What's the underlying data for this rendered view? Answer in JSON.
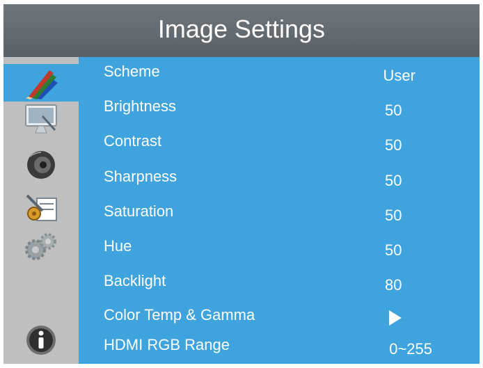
{
  "header": {
    "title": "Image Settings"
  },
  "sidebar": {
    "items": [
      {
        "icon": "color-pencils-icon",
        "active": true
      },
      {
        "icon": "monitor-icon",
        "active": false
      },
      {
        "icon": "speaker-icon",
        "active": false
      },
      {
        "icon": "tools-icon",
        "active": false
      },
      {
        "icon": "gears-icon",
        "active": false
      },
      {
        "icon": "info-icon",
        "active": false
      }
    ]
  },
  "menu": {
    "rows": [
      {
        "label": "Scheme",
        "value": "User"
      },
      {
        "label": "Brightness",
        "value": "50"
      },
      {
        "label": "Contrast",
        "value": "50"
      },
      {
        "label": "Sharpness",
        "value": "50"
      },
      {
        "label": "Saturation",
        "value": "50"
      },
      {
        "label": "Hue",
        "value": "50"
      },
      {
        "label": "Backlight",
        "value": "80"
      },
      {
        "label": "Color Temp & Gamma",
        "value": ""
      },
      {
        "label": "HDMI RGB Range",
        "value": "0~255"
      }
    ]
  },
  "colors": {
    "header_bg": "#5f676c",
    "panel_bg": "#3fa3dd",
    "sidebar_bg": "#bfbfbf",
    "text": "#ffffff"
  }
}
